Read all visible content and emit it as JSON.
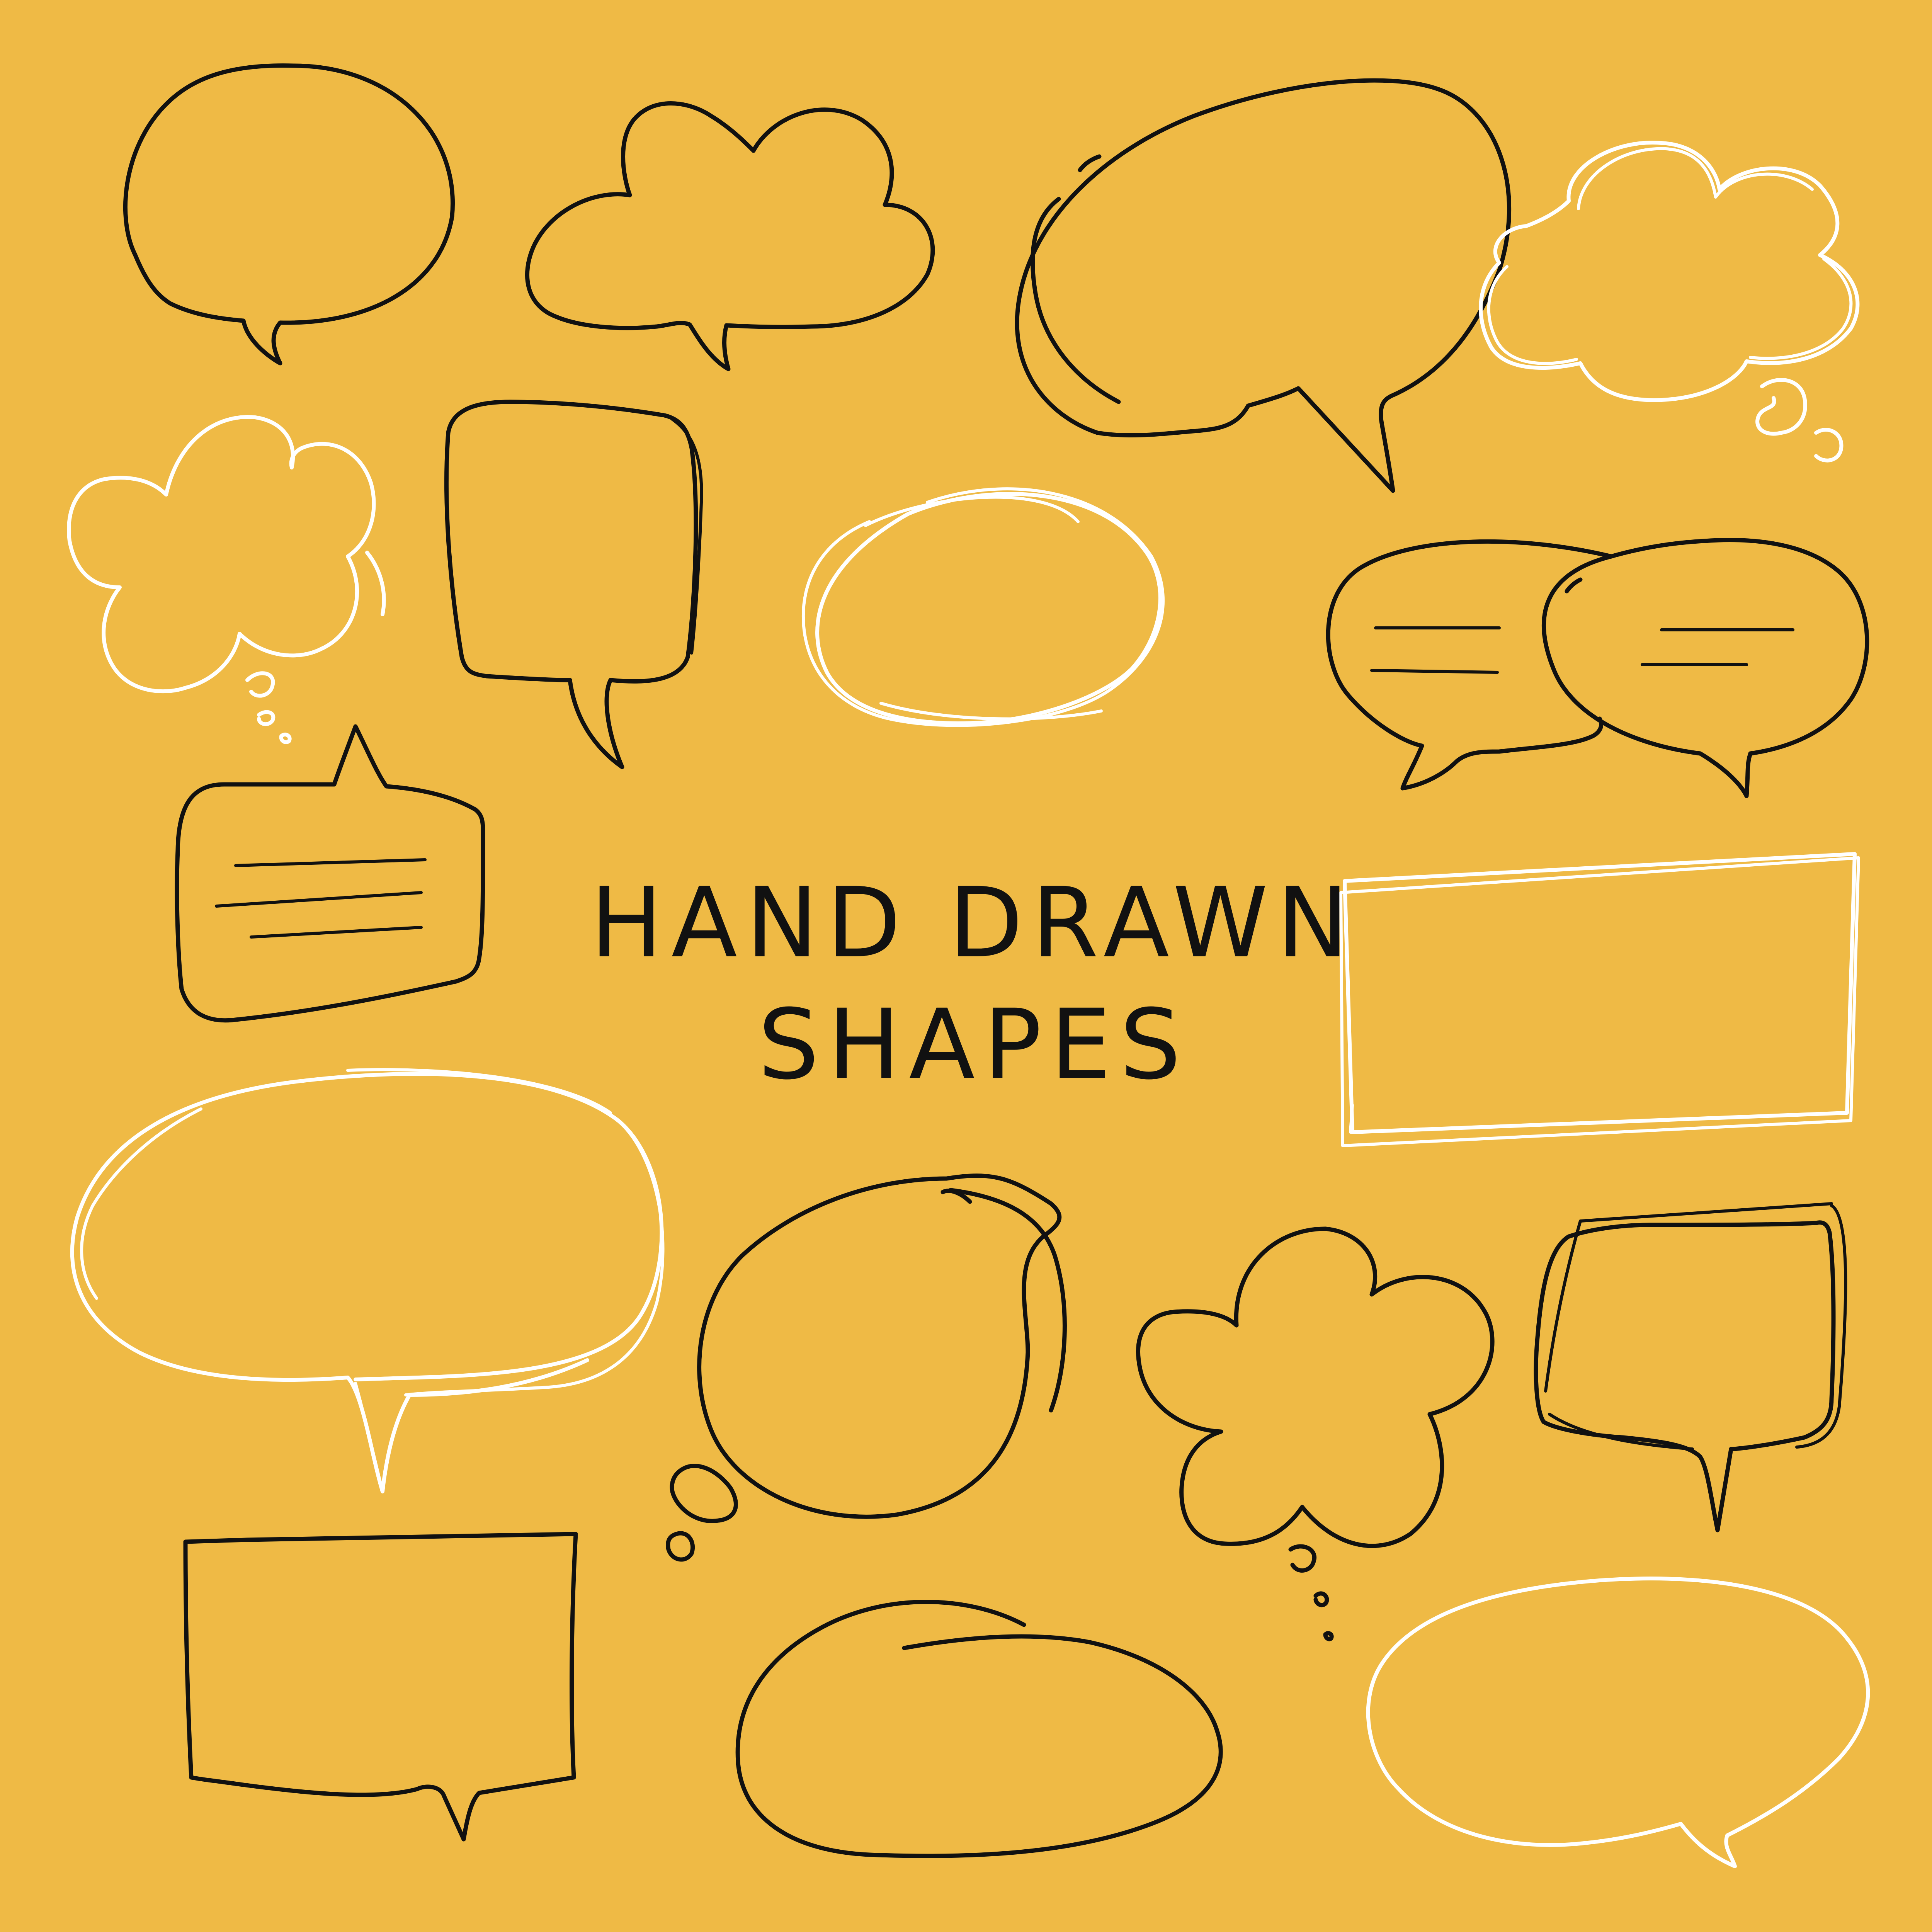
{
  "title": {
    "line1": "HAND DRAWN",
    "line2": "SHAPES"
  },
  "colors": {
    "background": "#EFBA45",
    "ink": "#111111",
    "chalk": "#FFFFFF"
  },
  "shapes": [
    {
      "kind": "speech-bubble-round",
      "color": "ink"
    },
    {
      "kind": "thought-cloud",
      "color": "ink"
    },
    {
      "kind": "speech-bubble-oval-large",
      "color": "ink"
    },
    {
      "kind": "thought-cloud",
      "color": "chalk"
    },
    {
      "kind": "thought-cloud",
      "color": "chalk"
    },
    {
      "kind": "speech-bubble-rectangle-tall",
      "color": "ink"
    },
    {
      "kind": "sketch-oval",
      "color": "chalk"
    },
    {
      "kind": "double-speech-bubble-with-lines",
      "color": "ink"
    },
    {
      "kind": "speech-bubble-rectangle-with-lines",
      "color": "ink"
    },
    {
      "kind": "sketch-rectangle",
      "color": "chalk"
    },
    {
      "kind": "speech-bubble-wide-oval",
      "color": "chalk"
    },
    {
      "kind": "thought-bubble-circle",
      "color": "ink"
    },
    {
      "kind": "thought-cloud",
      "color": "ink"
    },
    {
      "kind": "speech-bubble-rectangle-sketch",
      "color": "ink"
    },
    {
      "kind": "speech-bubble-square",
      "color": "ink"
    },
    {
      "kind": "sketch-oval-open",
      "color": "ink"
    },
    {
      "kind": "speech-bubble-oval",
      "color": "chalk"
    }
  ]
}
